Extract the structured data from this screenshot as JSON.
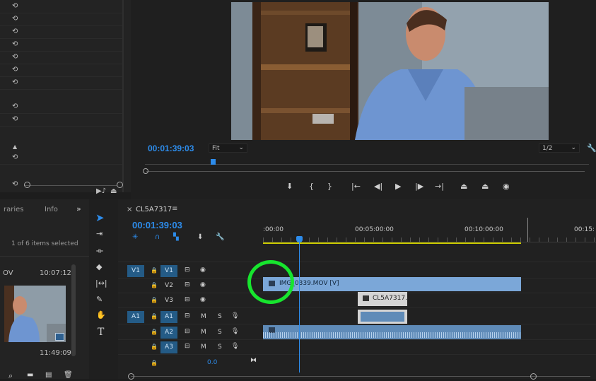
{
  "effect_controls": {
    "reset_icons": [
      "⟲",
      "⟲",
      "⟲",
      "⟲",
      "⟲",
      "⟲",
      "⟲",
      "⟲",
      "⟲",
      "⟲",
      "⟲"
    ]
  },
  "program_monitor": {
    "timecode": "00:01:39:03",
    "zoom_select": "Fit",
    "resolution_select": "1/2"
  },
  "project_panel": {
    "tabs": [
      "raries",
      "Info"
    ],
    "selection_status": "1 of 6 items selected",
    "items": [
      {
        "name": "OV",
        "duration": "10:07:12"
      },
      {
        "name": "",
        "duration": "11:49:09"
      }
    ]
  },
  "timeline": {
    "sequence_name": "CL5A7317",
    "timecode": "00:01:39:03",
    "ruler_labels": [
      ":00:00",
      "00:05:00:00",
      "00:10:00:00",
      "00:15:"
    ],
    "video_tracks": [
      {
        "label": "V3",
        "source": ""
      },
      {
        "label": "V2",
        "source": ""
      },
      {
        "label": "V1",
        "source": "V1"
      }
    ],
    "audio_tracks": [
      {
        "label": "A1",
        "source": "A1"
      },
      {
        "label": "A2",
        "source": ""
      },
      {
        "label": "A3",
        "source": ""
      }
    ],
    "mute_label": "M",
    "solo_label": "S",
    "master_volume": "0.0",
    "clips": {
      "v2_clip": "IMG_0339.MOV [V]",
      "v1_clip": "CL5A7317."
    }
  },
  "colors": {
    "accent_blue": "#2d8ceb",
    "clip_video": "#7ba7d8",
    "clip_audio": "#5f8bb8",
    "highlight_circle": "#17e52e",
    "work_area": "#cccc00"
  }
}
